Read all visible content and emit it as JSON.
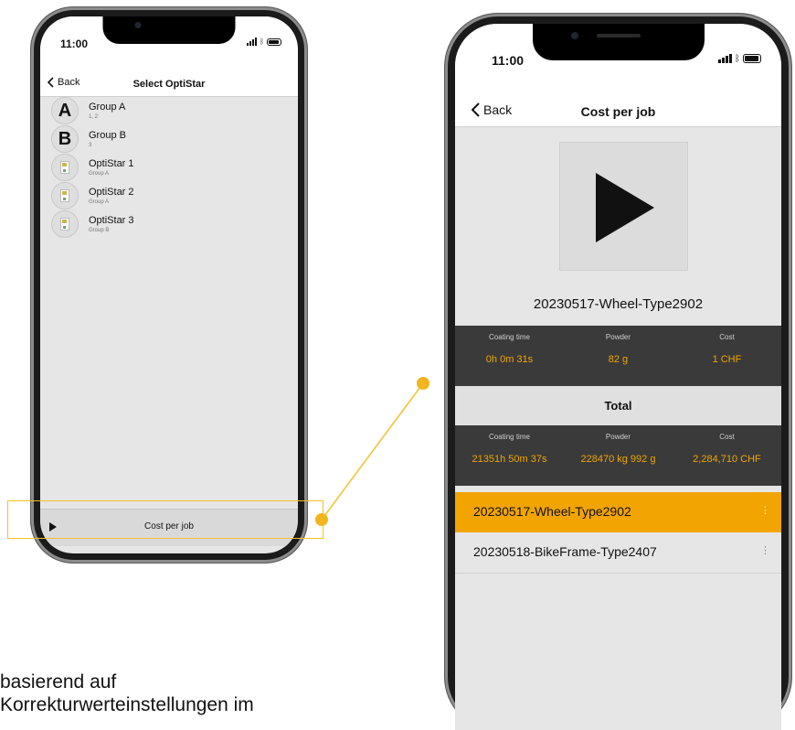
{
  "left_phone": {
    "time": "11:00",
    "back_label": "Back",
    "title": "Select OptiStar",
    "items": [
      {
        "badge": "A",
        "title": "Group A",
        "subtitle": "1, 2",
        "kind": "group"
      },
      {
        "badge": "B",
        "title": "Group B",
        "subtitle": "3",
        "kind": "group"
      },
      {
        "badge": "",
        "title": "OptiStar 1",
        "subtitle": "Group A",
        "kind": "device"
      },
      {
        "badge": "",
        "title": "OptiStar 2",
        "subtitle": "Group A",
        "kind": "device"
      },
      {
        "badge": "",
        "title": "OptiStar 3",
        "subtitle": "Group B",
        "kind": "device"
      }
    ],
    "bottom_bar_label": "Cost per job"
  },
  "right_phone": {
    "time": "11:00",
    "back_label": "Back",
    "title": "Cost per job",
    "job_name": "20230517-Wheel-Type2902",
    "job_stats": {
      "coating_time_label": "Coating time",
      "powder_label": "Powder",
      "cost_label": "Cost",
      "coating_time": "0h 0m 31s",
      "powder": "82 g",
      "cost": "1 CHF"
    },
    "total_label": "Total",
    "total_stats": {
      "coating_time_label": "Coating time",
      "powder_label": "Powder",
      "cost_label": "Cost",
      "coating_time": "21351h 50m 37s",
      "powder": "228470 kg 992 g",
      "cost": "2,284,710 CHF"
    },
    "jobs": [
      {
        "name": "20230517-Wheel-Type2902",
        "selected": true
      },
      {
        "name": "20230518-BikeFrame-Type2407",
        "selected": false
      }
    ]
  },
  "caption": {
    "line1": "basierend auf",
    "line2": "Korrekturwerteinstellungen im"
  },
  "colors": {
    "accent": "#f2a400",
    "highlight_outline": "#f2c12e",
    "stats_bg": "#3a3a3a",
    "stats_value": "#f0a500"
  },
  "icons": [
    "back-chevron-icon",
    "play-icon",
    "more-icon",
    "signal-icon",
    "bluetooth-icon",
    "battery-icon",
    "optistar-device-icon"
  ]
}
